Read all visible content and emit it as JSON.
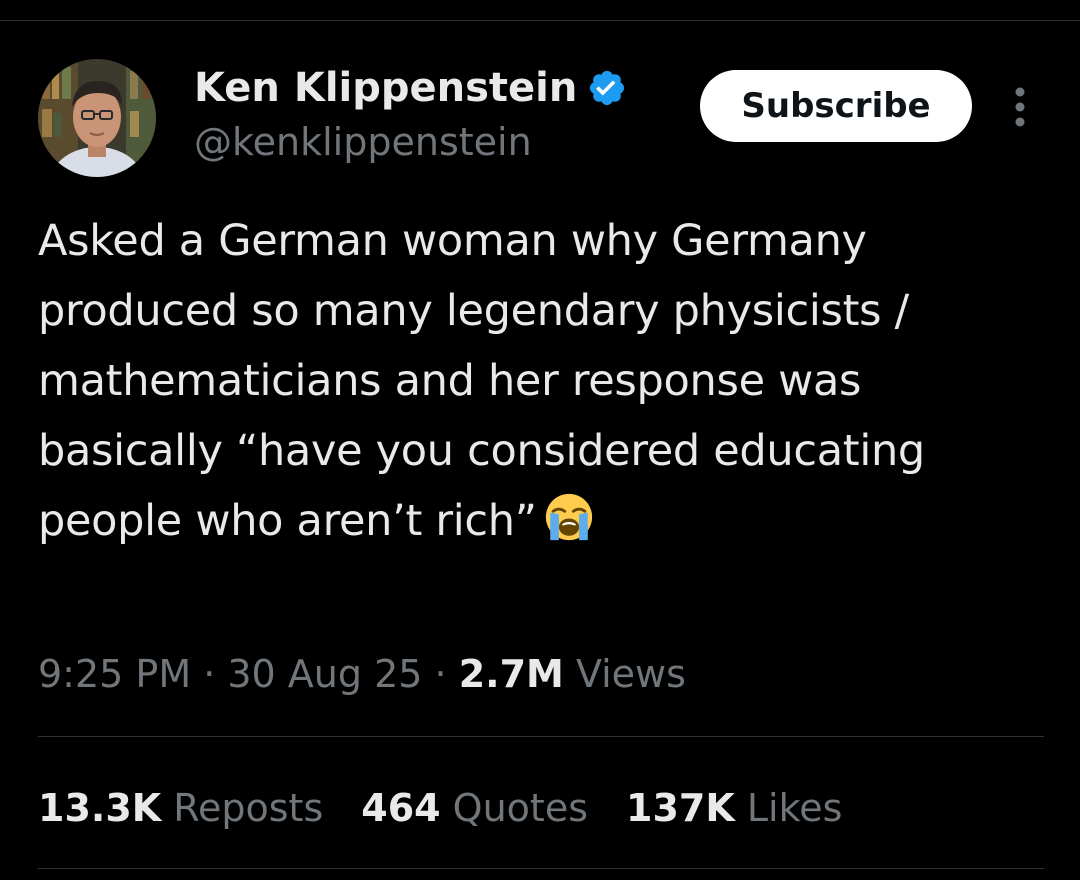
{
  "author": {
    "display_name": "Ken Klippenstein",
    "handle": "@kenklippenstein",
    "verified_icon": "verified-badge-icon",
    "verified_color": "#1d9bf0"
  },
  "actions": {
    "subscribe_label": "Subscribe",
    "more_icon": "more-vertical-icon"
  },
  "tweet": {
    "text": "Asked a German woman why Germany produced so many legendary physicists / mathematicians and her response was basically “have you considered educating people who aren’t rich”",
    "emoji_icon": "loudly-crying-face-icon"
  },
  "meta": {
    "time": "9:25 PM",
    "separator": " · ",
    "date": "30 Aug 25",
    "views_count": "2.7M",
    "views_label": "Views"
  },
  "stats": {
    "reposts_count": "13.3K",
    "reposts_label": "Reposts",
    "quotes_count": "464",
    "quotes_label": "Quotes",
    "likes_count": "137K",
    "likes_label": "Likes"
  },
  "colors": {
    "background": "#000000",
    "primary_text": "#e7e9ea",
    "secondary_text": "#71767b",
    "divider": "#2f3336",
    "accent": "#1d9bf0"
  }
}
